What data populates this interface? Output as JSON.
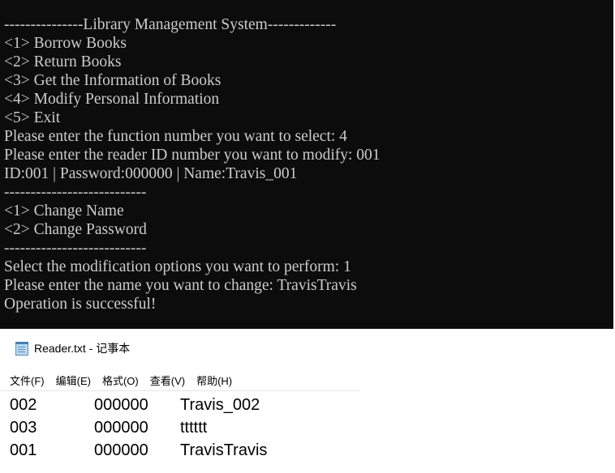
{
  "console": {
    "lines": [
      "---------------Library Management System-------------",
      "<1> Borrow Books",
      "<2> Return Books",
      "<3> Get the Information of Books",
      "<4> Modify Personal Information",
      "<5> Exit",
      "Please enter the function number you want to select: 4",
      "Please enter the reader ID number you want to modify: 001",
      "ID:001 | Password:000000 | Name:Travis_001",
      "---------------------------",
      "<1> Change Name",
      "<2> Change Password",
      "---------------------------",
      "Select the modification options you want to perform: 1",
      "Please enter the name you want to change: TravisTravis",
      "Operation is successful!"
    ]
  },
  "notepad": {
    "title": "Reader.txt - 记事本",
    "icon": "notepad-icon",
    "menu": [
      "文件(F)",
      "编辑(E)",
      "格式(O)",
      "查看(V)",
      "帮助(H)"
    ],
    "rows": [
      [
        "002",
        "000000",
        "Travis_002"
      ],
      [
        "003",
        "000000",
        "tttttt"
      ],
      [
        "001",
        "000000",
        "TravisTravis"
      ]
    ]
  },
  "colors": {
    "console_bg": "#0c0c0c",
    "console_text": "#cccccc",
    "notepad_bg": "#ffffff"
  }
}
